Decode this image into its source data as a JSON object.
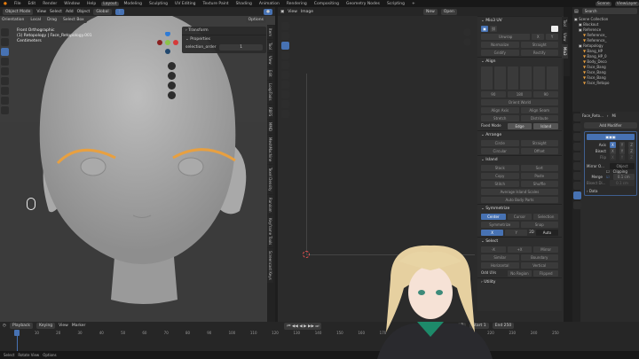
{
  "topbar": {
    "menus": [
      "File",
      "Edit",
      "Render",
      "Window",
      "Help"
    ],
    "workspaces": [
      "Layout",
      "Modeling",
      "Sculpting",
      "UV Editing",
      "Texture Paint",
      "Shading",
      "Animation",
      "Rendering",
      "Compositing",
      "Geometry Nodes",
      "Scripting"
    ],
    "active_workspace": "Layout",
    "scene": "Scene",
    "view_layer": "ViewLayer"
  },
  "viewport3d": {
    "mode": "Object Mode",
    "menus": [
      "View",
      "Select",
      "Add",
      "Object"
    ],
    "orientation": "Global",
    "transform_orientation_label": "Orientation",
    "pivot": "Local",
    "drag_label": "Drag",
    "drag_value": "Select Box",
    "options": "Options",
    "overlay_lines": [
      "Front Orthographic",
      "(1) Retopology | Face_Retopology.001",
      "Centimeters"
    ],
    "transform_panel": "Transform",
    "properties_panel": "Properties",
    "prop_name": "selection_order",
    "prop_value": "1",
    "side_tabs": [
      "Item",
      "Tool",
      "View",
      "Edit",
      "LoopTools",
      "RBFS",
      "MMD",
      "MeshMachine",
      "Texel Density",
      "Random",
      "Keyframe Tools",
      "Screencast Keys"
    ]
  },
  "uv_editor": {
    "menus": [
      "View",
      "Image"
    ],
    "new_label": "New",
    "open_label": "Open",
    "side_tabs": [
      "Tool",
      "View",
      "Mio3"
    ]
  },
  "npanel": {
    "title": "Mio3 UV",
    "unwrap": "Unwrap",
    "x": "X",
    "y": "Y",
    "normalize": "Normalize",
    "straight": "Straight",
    "gridify": "Gridify",
    "rectify": "Rectify",
    "align": "Align",
    "rot": [
      "90",
      "180",
      "90"
    ],
    "orient_world": "Orient World",
    "align_axis": "Align Axis",
    "align_seam": "Align Seam",
    "stretch": "Stretch",
    "distribute": "Distribute",
    "fixed_mode": "Fixed Mode",
    "edge": "Edge",
    "island": "Island",
    "arrange": "Arrange",
    "circle": "Circle",
    "straight2": "Straight",
    "circular": "Circular",
    "offset": "Offset",
    "island_sec": "Island",
    "stack": "Stack",
    "sort": "Sort",
    "copy": "Copy",
    "paste": "Paste",
    "stitch": "Stitch",
    "shuffle": "Shuffle",
    "avg_scale": "Average Island Scales",
    "auto_body": "Auto Body Parts",
    "symmetrize": "Symmetrize",
    "center": "Center",
    "cursor": "Cursor",
    "selection": "Selection",
    "symmetrize_btn": "Symmetrize",
    "snap": "Snap",
    "sx": "X",
    "sy": "Y",
    "mode_2d": "2D",
    "auto": "Auto",
    "select": "Select",
    "neg_x": "-X",
    "pos_x": "+X",
    "mirror": "Mirror",
    "similar": "Similar",
    "boundary": "Boundary",
    "horizontal": "Horizontal",
    "vertical": "Vertical",
    "odd_uvs": "Odd UVs",
    "no_region": "No Region",
    "flipped": "Flipped",
    "utility": "Utility"
  },
  "outliner": {
    "search_placeholder": "Search",
    "items": [
      {
        "label": "Scene Collection",
        "depth": 0
      },
      {
        "label": "Blockout",
        "depth": 1
      },
      {
        "label": "Reference",
        "depth": 1
      },
      {
        "label": "Reference_",
        "depth": 2
      },
      {
        "label": "Reference_",
        "depth": 2
      },
      {
        "label": "Retopology",
        "depth": 1
      },
      {
        "label": "Bang_HP",
        "depth": 2
      },
      {
        "label": "Bang_HP_0",
        "depth": 2
      },
      {
        "label": "Body_Deco",
        "depth": 2
      },
      {
        "label": "Face_Bang",
        "depth": 2
      },
      {
        "label": "Face_Bang",
        "depth": 2
      },
      {
        "label": "Face_Bang",
        "depth": 2
      },
      {
        "label": "Face_Retopo",
        "depth": 2
      }
    ]
  },
  "properties": {
    "breadcrumb_obj": "Face_Reto...",
    "breadcrumb_mod": "Mi",
    "add_modifier": "Add Modifier",
    "axis_label": "Axis",
    "bisect_label": "Bisect",
    "flip_label": "Flip",
    "axes": [
      "X",
      "Y",
      "Z"
    ],
    "mirror_obj_label": "Mirror O...",
    "object_placeholder": "Object",
    "clipping": "Clipping",
    "merge_label": "Merge",
    "merge_value": "0.1 cm",
    "bisect_dist_label": "Bisect Di...",
    "bisect_dist_value": "0.1 cm",
    "data": "Data"
  },
  "timeline": {
    "menus": [
      "Playback",
      "Keying",
      "View",
      "Marker"
    ],
    "current_frame": "1",
    "start_label": "Start",
    "start": "1",
    "end_label": "End",
    "end": "250",
    "ticks": [
      "1",
      "10",
      "20",
      "30",
      "40",
      "50",
      "60",
      "70",
      "80",
      "90",
      "100",
      "110",
      "120",
      "130",
      "140",
      "150",
      "160",
      "170",
      "180",
      "190",
      "200",
      "210",
      "220",
      "230",
      "240",
      "250"
    ]
  },
  "status": {
    "items": [
      "Select",
      "Rotate View",
      "Options"
    ]
  },
  "colors": {
    "accent": "#4772b3",
    "selection_outline": "#e8a040"
  }
}
